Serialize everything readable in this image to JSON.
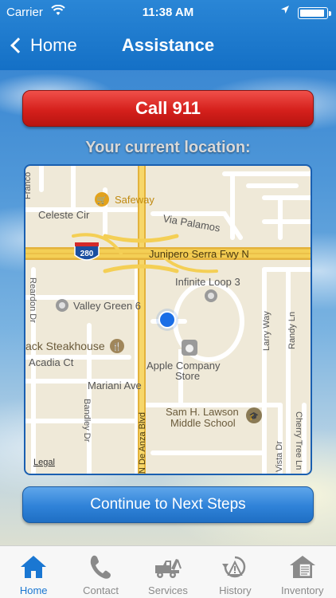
{
  "status_bar": {
    "carrier": "Carrier",
    "time": "11:38 AM"
  },
  "nav": {
    "back_label": "Home",
    "title": "Assistance"
  },
  "call_button": {
    "label": "Call 911"
  },
  "location_label": "Your current location:",
  "map": {
    "labels": {
      "franco": "Franco",
      "safeway": "Safeway",
      "celeste": "Celeste Cir",
      "via_palamos": "Via Palamos",
      "hwy_shield": "280",
      "junipero": "Junipero Serra Fwy N",
      "reardon": "Reardon Dr",
      "infinite_loop": "Infinite Loop 3",
      "valley_green": "Valley Green 6",
      "steakhouse": "ack Steakhouse",
      "acadia": "Acadia Ct",
      "apple_store": "Apple Company",
      "apple_store2": "Store",
      "larry": "Larry Way",
      "randy": "Randy Ln",
      "mariani": "Mariani Ave",
      "bandley": "Bandley Dr",
      "de_anza": "N De Anza Blvd",
      "sam_lawson": "Sam H. Lawson",
      "middle_school": "Middle School",
      "vista": "Vista Dr",
      "cherry_tree": "Cherry Tree Ln",
      "legal": "Legal"
    }
  },
  "continue_button": {
    "label": "Continue to Next Steps"
  },
  "tabs": [
    {
      "label": "Home",
      "icon": "home-icon",
      "active": true
    },
    {
      "label": "Contact",
      "icon": "phone-icon",
      "active": false
    },
    {
      "label": "Services",
      "icon": "tow-truck-icon",
      "active": false
    },
    {
      "label": "History",
      "icon": "history-icon",
      "active": false
    },
    {
      "label": "Inventory",
      "icon": "inventory-icon",
      "active": false
    }
  ],
  "colors": {
    "nav_blue": "#1470c6",
    "call_red": "#d5201c",
    "tab_active": "#1a77d2",
    "tab_inactive": "#8a8a8a",
    "location_dot": "#1a6ee6"
  }
}
